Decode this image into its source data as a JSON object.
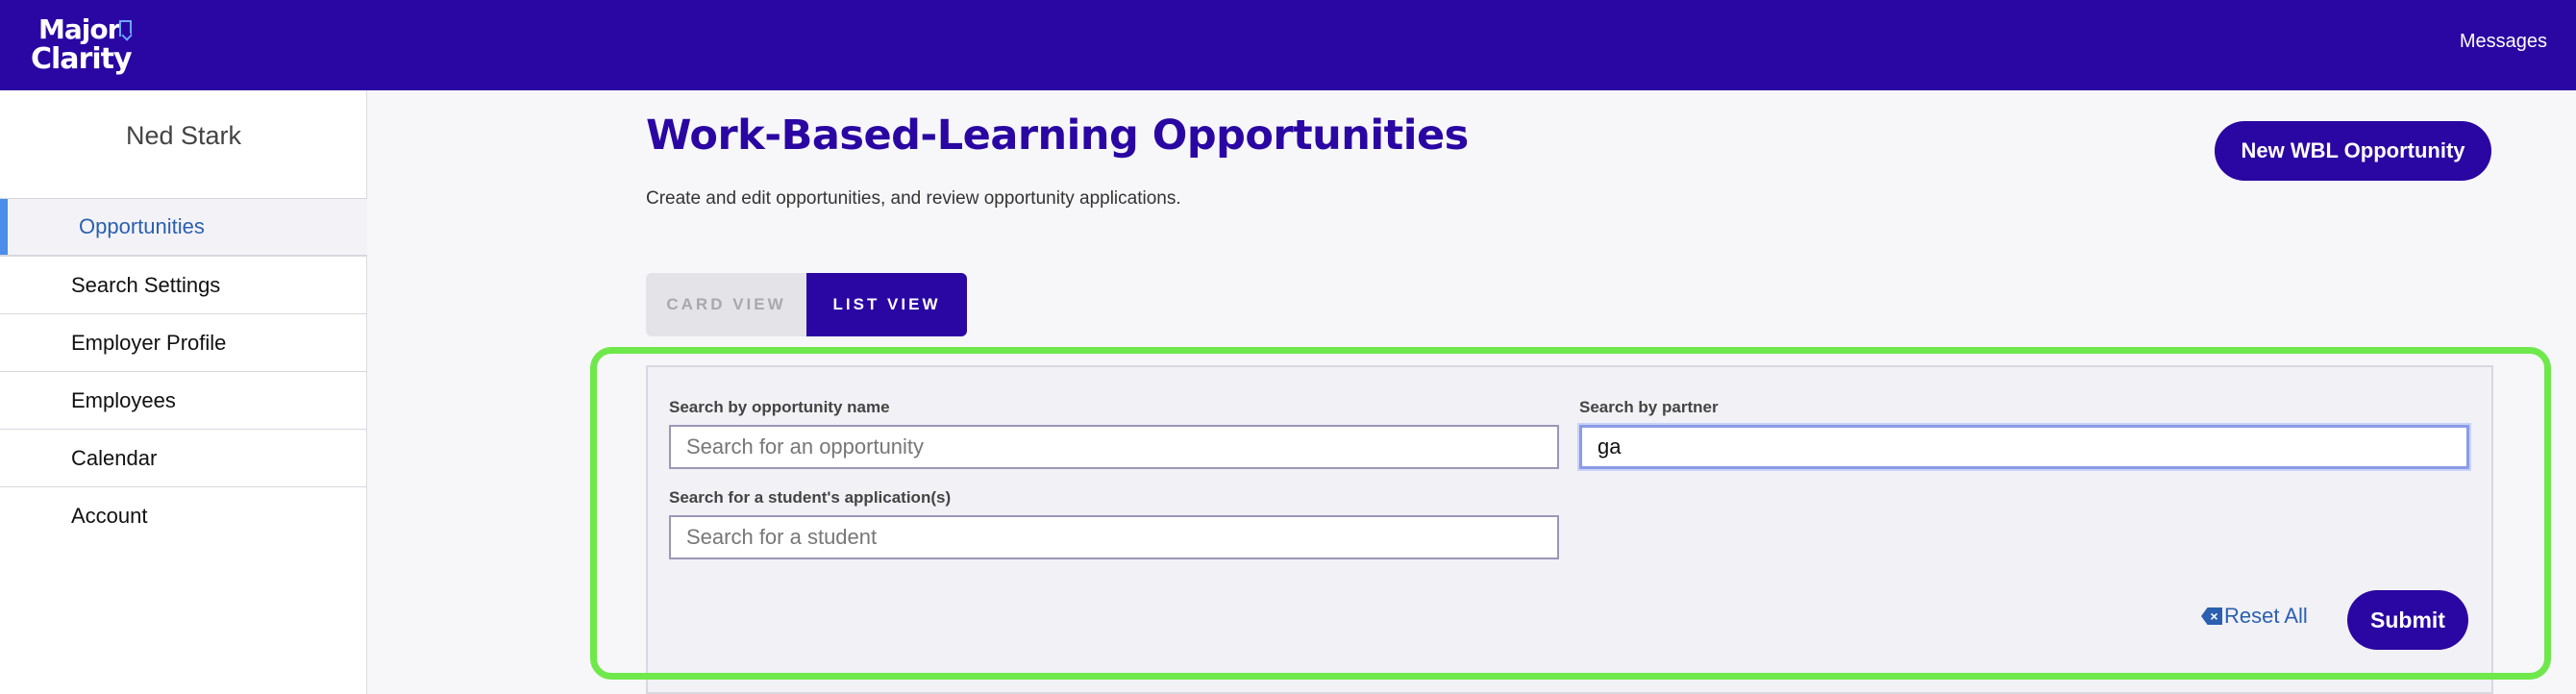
{
  "header": {
    "logo_line1": "Major",
    "logo_line2": "Clarity",
    "messages_label": "Messages",
    "accent_color": "#2a06a3"
  },
  "sidebar": {
    "user_name": "Ned Stark",
    "items": [
      {
        "label": "Opportunities",
        "active": true
      },
      {
        "label": "Search Settings",
        "active": false
      },
      {
        "label": "Employer Profile",
        "active": false
      },
      {
        "label": "Employees",
        "active": false
      },
      {
        "label": "Calendar",
        "active": false
      },
      {
        "label": "Account",
        "active": false
      }
    ]
  },
  "main": {
    "title": "Work-Based-Learning Opportunities",
    "subtitle": "Create and edit opportunities, and review opportunity applications.",
    "new_button_label": "New WBL Opportunity",
    "view_toggle": {
      "card_label": "CARD VIEW",
      "list_label": "LIST VIEW",
      "selected": "LIST VIEW"
    },
    "search": {
      "opportunity_label": "Search by opportunity name",
      "opportunity_placeholder": "Search for an opportunity",
      "opportunity_value": "",
      "partner_label": "Search by partner",
      "partner_value": "ga",
      "student_label": "Search for a student's application(s)",
      "student_placeholder": "Search for a student",
      "student_value": "",
      "reset_label": "Reset All",
      "submit_label": "Submit"
    },
    "highlight_color": "#6fe84b"
  }
}
